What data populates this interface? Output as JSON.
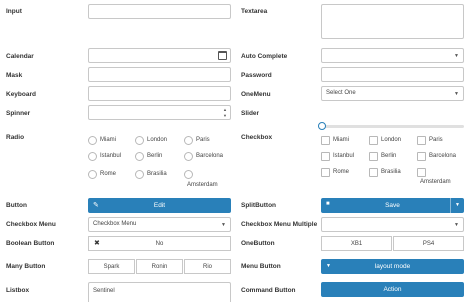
{
  "labels": {
    "input": "Input",
    "textarea": "Textarea",
    "calendar": "Calendar",
    "autocomplete": "Auto Complete",
    "mask": "Mask",
    "password": "Password",
    "keyboard": "Keyboard",
    "onemenu": "OneMenu",
    "spinner": "Spinner",
    "slider": "Slider",
    "radio": "Radio",
    "checkbox": "Checkbox",
    "button": "Button",
    "splitbutton": "SplitButton",
    "checkboxmenu": "Checkbox Menu",
    "checkboxmenumultiple": "Checkbox Menu Multiple",
    "booleanbutton": "Boolean Button",
    "onebutton": "OneButton",
    "manybutton": "Many Button",
    "menubutton": "Menu Button",
    "listbox": "Listbox",
    "commandbutton": "Command Button"
  },
  "onemenu": {
    "value": "Select One"
  },
  "slider": {
    "value": 0
  },
  "radio_options": [
    "Miami",
    "London",
    "Paris",
    "Istanbul",
    "Berlin",
    "Barcelona",
    "Rome",
    "Brasilia",
    "Amsterdam"
  ],
  "checkbox_options": [
    "Miami",
    "London",
    "Paris",
    "Istanbul",
    "Berlin",
    "Barcelona",
    "Rome",
    "Brasilia",
    "Amsterdam"
  ],
  "edit_button": {
    "label": "Edit",
    "icon": "pencil-square-icon"
  },
  "split_button": {
    "label": "Save",
    "icon": "floppy-disk-icon"
  },
  "checkbox_menu": {
    "placeholder": "Checkbox Menu"
  },
  "boolean_button": {
    "label": "No",
    "icon": "close-icon"
  },
  "one_button": {
    "options": [
      "XB1",
      "PS4"
    ]
  },
  "many_button": {
    "options": [
      "Spark",
      "Ronin",
      "Rio"
    ]
  },
  "menu_button": {
    "label": "layout mode",
    "icon": "chevron-down-icon"
  },
  "listbox": {
    "items": [
      "Sentinel"
    ]
  },
  "command_button": {
    "label": "Action"
  },
  "colors": {
    "accent": "#2980b9",
    "border": "#c8c8c8"
  }
}
